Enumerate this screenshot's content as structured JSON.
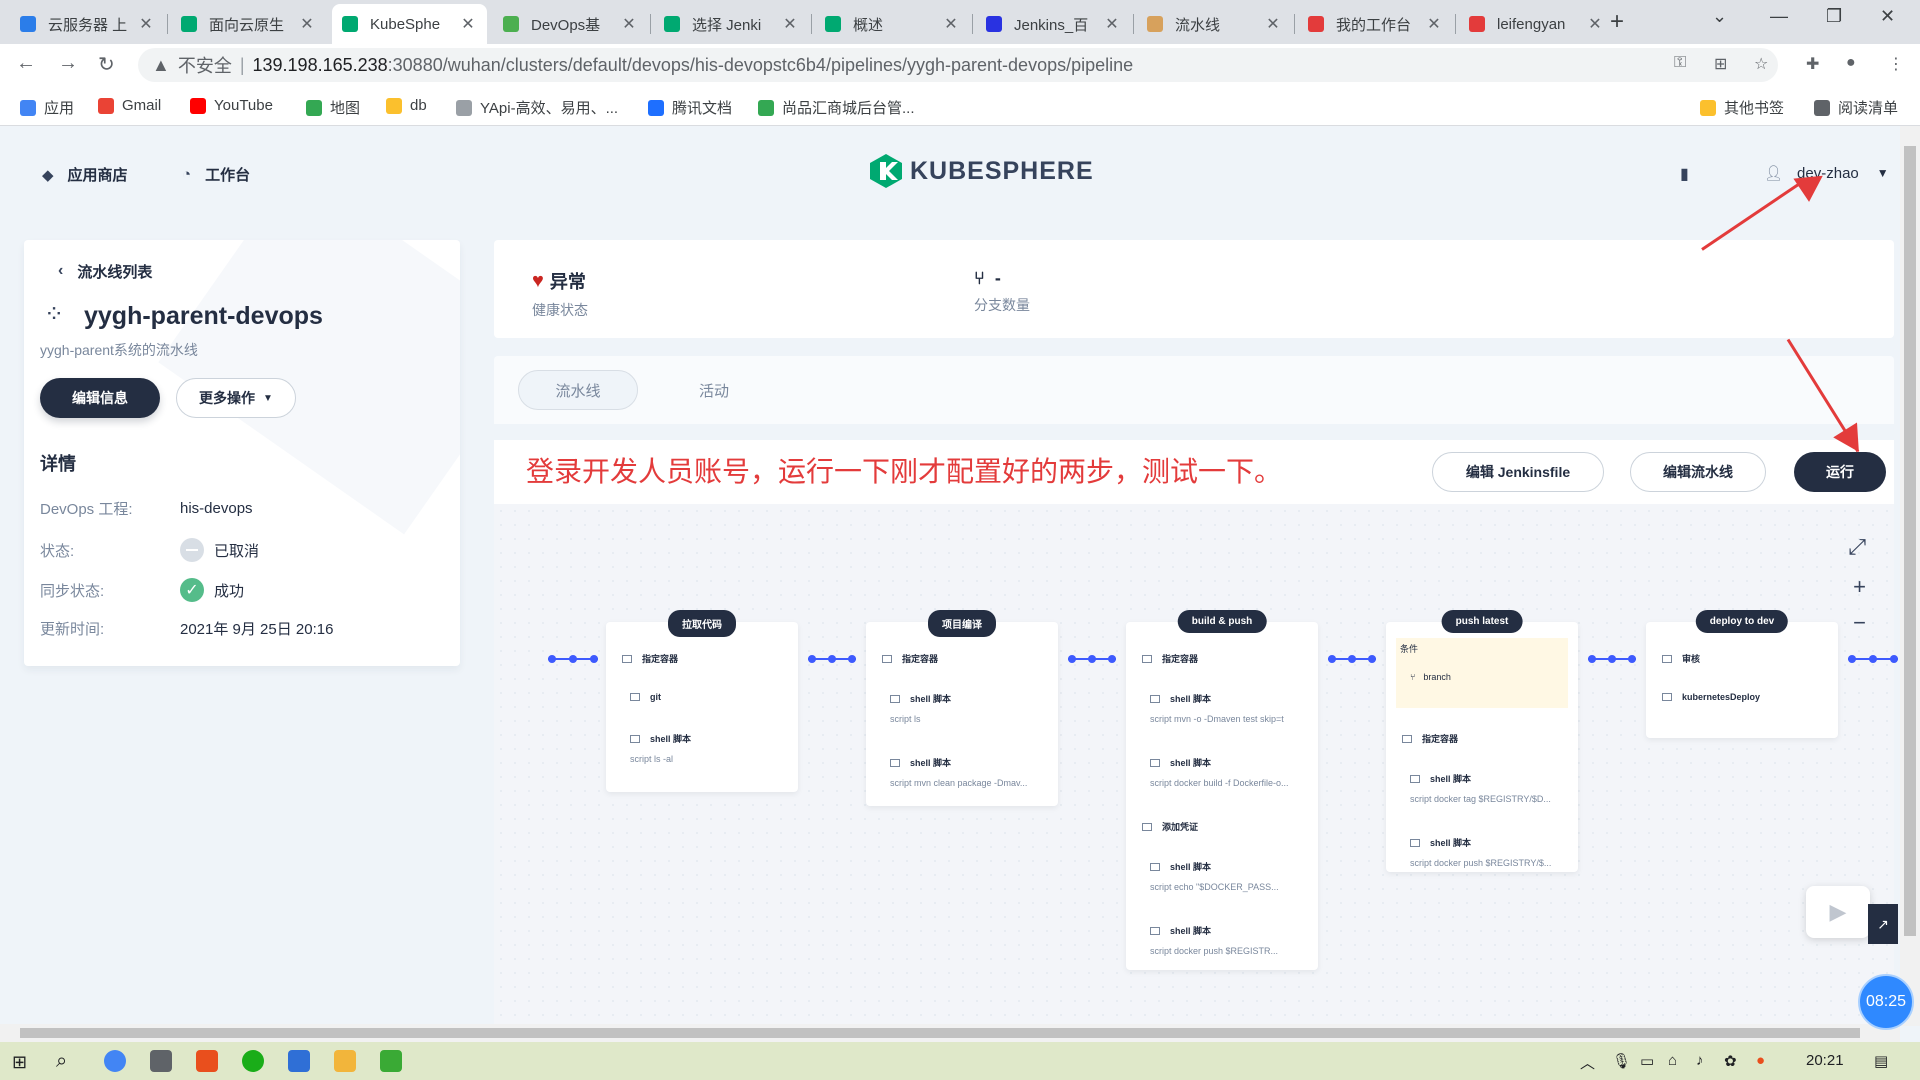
{
  "browser": {
    "tabs": [
      {
        "label": "云服务器 上",
        "color": "#2b7de9"
      },
      {
        "label": "面向云原生",
        "color": "#00a971"
      },
      {
        "label": "KubeSphe",
        "color": "#00a971",
        "active": true
      },
      {
        "label": "DevOps基",
        "color": "#4caf50"
      },
      {
        "label": "选择 Jenki",
        "color": "#00a971"
      },
      {
        "label": "概述",
        "color": "#00a971"
      },
      {
        "label": "Jenkins_百",
        "color": "#2932e1"
      },
      {
        "label": "流水线",
        "color": "#d7a15c"
      },
      {
        "label": "我的工作台",
        "color": "#e33b3b"
      },
      {
        "label": "leifengyan",
        "color": "#e33b3b"
      }
    ],
    "url_insecure": "不安全",
    "url_host": "139.198.165.238",
    "url_path": ":30880/wuhan/clusters/default/devops/his-devopstc6b4/pipelines/yygh-parent-devops/pipeline",
    "bookmarks": [
      {
        "label": "应用",
        "color": "#4285f4"
      },
      {
        "label": "Gmail",
        "color": "#ea4335"
      },
      {
        "label": "YouTube",
        "color": "#ff0000"
      },
      {
        "label": "地图",
        "color": "#34a853"
      },
      {
        "label": "db",
        "color": "#fbc02d"
      },
      {
        "label": "YApi-高效、易用、...",
        "color": "#9aa0a6"
      },
      {
        "label": "腾讯文档",
        "color": "#1e6fff"
      },
      {
        "label": "尚品汇商城后台管...",
        "color": "#34a853"
      }
    ],
    "bookmarks_right": [
      {
        "label": "其他书签",
        "color": "#fbc02d"
      },
      {
        "label": "阅读清单",
        "color": "#5f6368"
      }
    ]
  },
  "header": {
    "nav": [
      {
        "label": "应用商店",
        "icon": "app-store-icon"
      },
      {
        "label": "工作台",
        "icon": "workbench-icon"
      }
    ],
    "logo": "KUBESPHERE",
    "username": "dev-zhao"
  },
  "sidebar": {
    "back_label": "流水线列表",
    "title": "yygh-parent-devops",
    "description": "yygh-parent系统的流水线",
    "edit_label": "编辑信息",
    "more_label": "更多操作",
    "details_title": "详情",
    "details": [
      {
        "label": "DevOps 工程:",
        "value": "his-devops",
        "kind": "text"
      },
      {
        "label": "状态:",
        "value": "已取消",
        "kind": "cancelled"
      },
      {
        "label": "同步状态:",
        "value": "成功",
        "kind": "success"
      },
      {
        "label": "更新时间:",
        "value": "2021年 9月 25日 20:16",
        "kind": "text"
      }
    ]
  },
  "status": {
    "health_value": "异常",
    "health_label": "健康状态",
    "branch_value": "-",
    "branch_label": "分支数量"
  },
  "tabs": [
    {
      "label": "流水线",
      "active": true
    },
    {
      "label": "活动",
      "active": false
    }
  ],
  "actions": {
    "annotation": "登录开发人员账号，运行一下刚才配置好的两步，测试一下。",
    "edit_jenkinsfile": "编辑 Jenkinsfile",
    "edit_pipeline": "编辑流水线",
    "run": "运行"
  },
  "pipeline": {
    "stages": [
      {
        "name": "拉取代码",
        "steps": [
          {
            "title": "指定容器",
            "sub": ""
          },
          {
            "title": "git",
            "sub": "",
            "inner": true
          },
          {
            "title": "shell 脚本",
            "sub": "script   ls -al",
            "inner": true
          }
        ]
      },
      {
        "name": "项目编译",
        "steps": [
          {
            "title": "指定容器",
            "sub": ""
          },
          {
            "title": "shell 脚本",
            "sub": "script   ls",
            "inner": true
          },
          {
            "title": "shell 脚本",
            "sub": "script   mvn clean package -Dmav...",
            "inner": true
          }
        ]
      },
      {
        "name": "build & push",
        "steps": [
          {
            "title": "指定容器",
            "sub": ""
          },
          {
            "title": "shell 脚本",
            "sub": "script   mvn -o -Dmaven test skip=t",
            "inner": true
          },
          {
            "title": "shell 脚本",
            "sub": "script   docker build -f Dockerfile-o...",
            "inner": true
          },
          {
            "title": "添加凭证",
            "sub": ""
          },
          {
            "title": "shell 脚本",
            "sub": "script   echo \"$DOCKER_PASS...",
            "inner": true
          },
          {
            "title": "shell 脚本",
            "sub": "script   docker push $REGISTR...",
            "inner": true
          }
        ]
      },
      {
        "name": "push latest",
        "condition_label": "条件",
        "condition": "branch",
        "steps": [
          {
            "title": "指定容器",
            "sub": ""
          },
          {
            "title": "shell 脚本",
            "sub": "script   docker tag $REGISTRY/$D...",
            "inner": true
          },
          {
            "title": "shell 脚本",
            "sub": "script   docker push $REGISTRY/$...",
            "inner": true
          }
        ]
      },
      {
        "name": "deploy to dev",
        "steps": [
          {
            "title": "审核",
            "sub": ""
          },
          {
            "title": "kubernetesDeploy",
            "sub": ""
          }
        ]
      }
    ]
  },
  "overlay": {
    "timer": "08:25"
  },
  "taskbar": {
    "time": "20:21"
  }
}
